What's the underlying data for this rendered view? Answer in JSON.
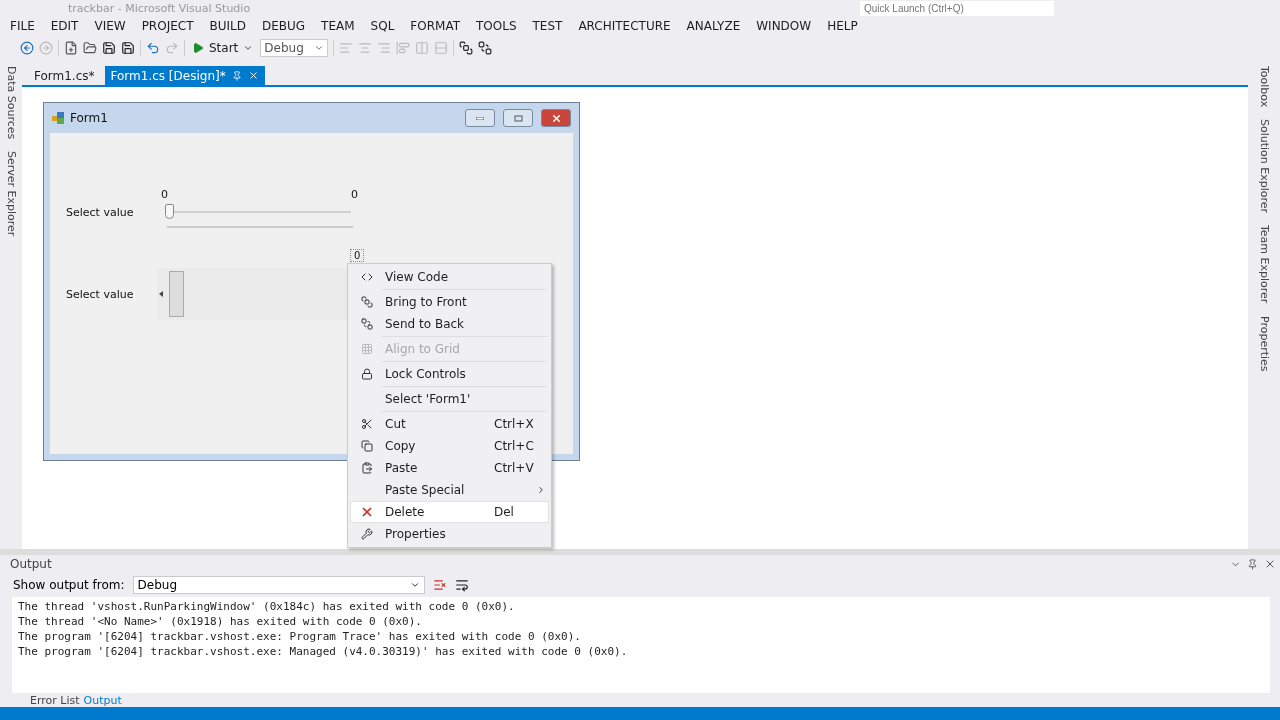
{
  "window": {
    "title": "trackbar - Microsoft Visual Studio"
  },
  "quick_launch": {
    "placeholder": "Quick Launch (Ctrl+Q)"
  },
  "menu": [
    "FILE",
    "EDIT",
    "VIEW",
    "PROJECT",
    "BUILD",
    "DEBUG",
    "TEAM",
    "SQL",
    "FORMAT",
    "TOOLS",
    "TEST",
    "ARCHITECTURE",
    "ANALYZE",
    "WINDOW",
    "HELP"
  ],
  "toolbar": {
    "start_label": "Start",
    "configuration": "Debug"
  },
  "doc_tabs": [
    {
      "label": "Form1.cs*",
      "selected": false
    },
    {
      "label": "Form1.cs [Design]*",
      "selected": true
    }
  ],
  "left_tabs": [
    "Data Sources",
    "Server Explorer"
  ],
  "right_tabs": [
    "Toolbox",
    "Solution Explorer",
    "Team Explorer",
    "Properties"
  ],
  "form": {
    "title": "Form1",
    "rows": [
      {
        "kind": "trackbar",
        "label": "Select value",
        "min_label": "0",
        "max_label": "0",
        "level": 0
      },
      {
        "kind": "scrollbar",
        "label": "Select value",
        "value_label": "0"
      }
    ]
  },
  "context_menu": [
    {
      "label": "View Code",
      "disabled": false,
      "selected": false,
      "submenu": false
    },
    {
      "label": "Bring to Front",
      "disabled": false,
      "selected": false,
      "submenu": false
    },
    {
      "label": "Send to Back",
      "disabled": false,
      "selected": false,
      "submenu": false
    },
    {
      "label": "Align to Grid",
      "disabled": true,
      "selected": false,
      "submenu": false
    },
    {
      "label": "Lock Controls",
      "disabled": false,
      "selected": false,
      "submenu": false
    },
    {
      "label": "Select 'Form1'",
      "disabled": false,
      "selected": false,
      "submenu": false
    },
    {
      "label": "Cut",
      "shortcut": "Ctrl+X",
      "disabled": false,
      "selected": false,
      "submenu": false
    },
    {
      "label": "Copy",
      "shortcut": "Ctrl+C",
      "disabled": false,
      "selected": false,
      "submenu": false
    },
    {
      "label": "Paste",
      "shortcut": "Ctrl+V",
      "disabled": false,
      "selected": false,
      "submenu": false
    },
    {
      "label": "Paste Special",
      "disabled": false,
      "selected": false,
      "submenu": true
    },
    {
      "label": "Delete",
      "shortcut": "Del",
      "disabled": false,
      "selected": true,
      "submenu": false
    },
    {
      "label": "Properties",
      "disabled": false,
      "selected": false,
      "submenu": false
    }
  ],
  "output": {
    "title": "Output",
    "source_label": "Show output from:",
    "source_value": "Debug",
    "lines": [
      "The thread 'vshost.RunParkingWindow' (0x184c) has exited with code 0 (0x0).",
      "The thread '<No Name>' (0x1918) has exited with code 0 (0x0).",
      "The program '[6204] trackbar.vshost.exe: Program Trace' has exited with code 0 (0x0).",
      "The program '[6204] trackbar.vshost.exe: Managed (v4.0.30319)' has exited with code 0 (0x0)."
    ],
    "tabs": [
      {
        "label": "Error List",
        "selected": false
      },
      {
        "label": "Output",
        "selected": true
      }
    ]
  }
}
